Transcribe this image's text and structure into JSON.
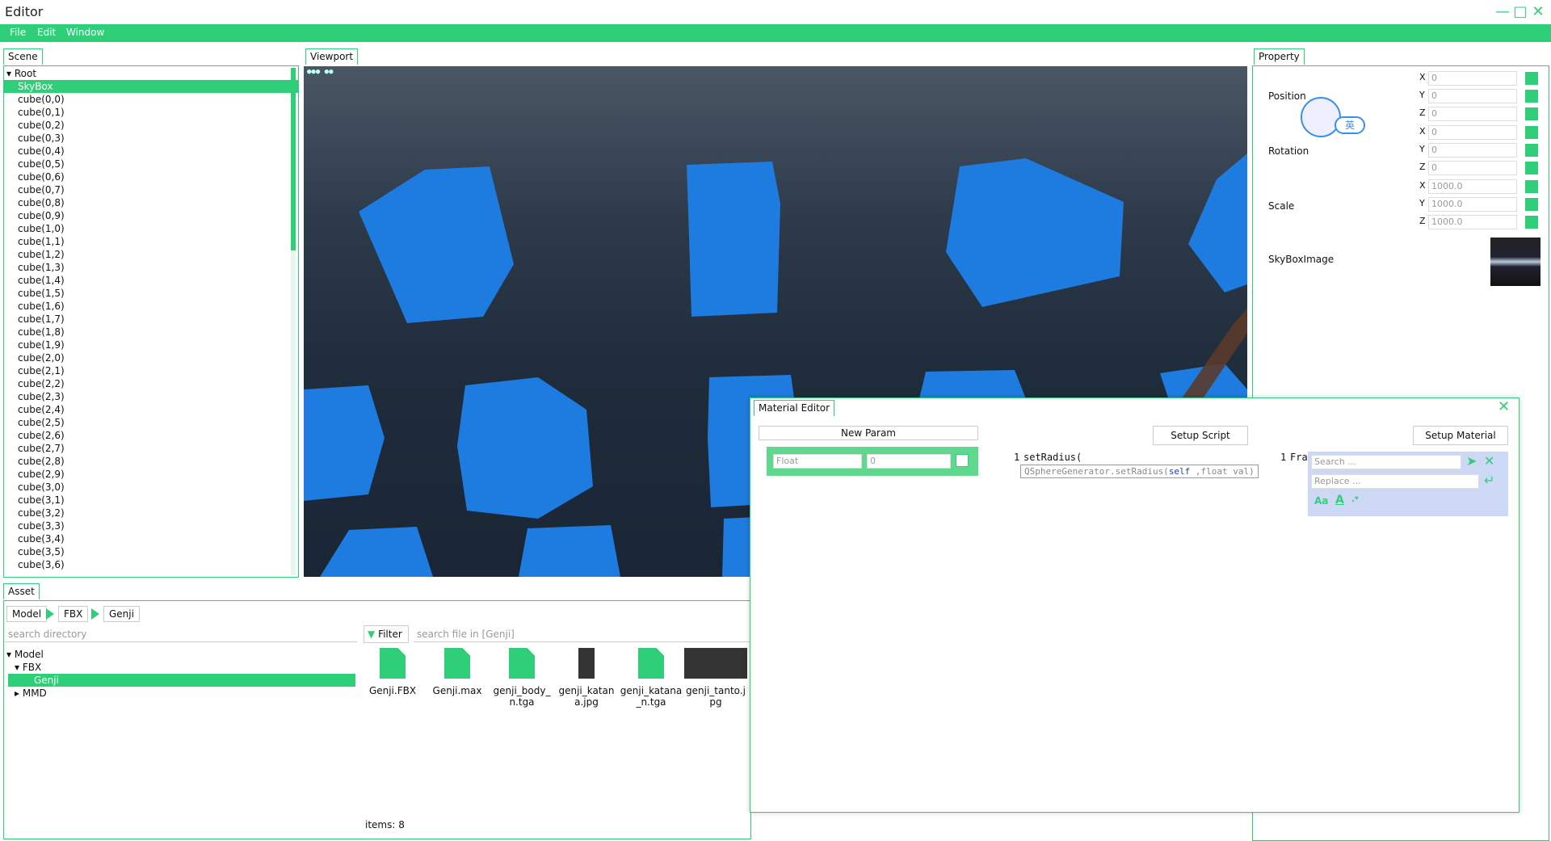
{
  "window": {
    "title": "Editor"
  },
  "menu": [
    "File",
    "Edit",
    "Window"
  ],
  "scene": {
    "tab": "Scene",
    "root": "Root",
    "selected": "SkyBox",
    "items": [
      "cube(0,0)",
      "cube(0,1)",
      "cube(0,2)",
      "cube(0,3)",
      "cube(0,4)",
      "cube(0,5)",
      "cube(0,6)",
      "cube(0,7)",
      "cube(0,8)",
      "cube(0,9)",
      "cube(1,0)",
      "cube(1,1)",
      "cube(1,2)",
      "cube(1,3)",
      "cube(1,4)",
      "cube(1,5)",
      "cube(1,6)",
      "cube(1,7)",
      "cube(1,8)",
      "cube(1,9)",
      "cube(2,0)",
      "cube(2,1)",
      "cube(2,2)",
      "cube(2,3)",
      "cube(2,4)",
      "cube(2,5)",
      "cube(2,6)",
      "cube(2,7)",
      "cube(2,8)",
      "cube(2,9)",
      "cube(3,0)",
      "cube(3,1)",
      "cube(3,2)",
      "cube(3,3)",
      "cube(3,4)",
      "cube(3,5)",
      "cube(3,6)"
    ]
  },
  "viewport": {
    "tab": "Viewport",
    "fps": "●●● ●●"
  },
  "property": {
    "tab": "Property",
    "position_label": "Position",
    "rotation_label": "Rotation",
    "scale_label": "Scale",
    "skybox_label": "SkyBoxImage",
    "position": [
      "0",
      "0",
      "0"
    ],
    "rotation": [
      "0",
      "0",
      "0"
    ],
    "scale": [
      "1000.0",
      "1000.0",
      "1000.0"
    ],
    "axes": [
      "X",
      "Y",
      "Z"
    ],
    "ime_badge": "英"
  },
  "asset": {
    "tab": "Asset",
    "breadcrumb": [
      "Model",
      "FBX",
      "Genji"
    ],
    "search_dir_placeholder": "search directory",
    "filter_label": "Filter",
    "search_file_placeholder": "search file in [Genji]",
    "tree": {
      "model": "Model",
      "fbx": "FBX",
      "genji": "Genji",
      "mmd": "MMD"
    },
    "files": [
      {
        "name": "Genji.FBX",
        "kind": "file"
      },
      {
        "name": "Genji.max",
        "kind": "file"
      },
      {
        "name": "genji_body_n.tga",
        "kind": "file"
      },
      {
        "name": "genji_katana.jpg",
        "kind": "thumb"
      },
      {
        "name": "genji_katana_n.tga",
        "kind": "file"
      },
      {
        "name": "genji_tanto.jpg",
        "kind": "thumb"
      }
    ],
    "items_count": "items: 8"
  },
  "material_editor": {
    "title": "Material Editor",
    "new_param": "New Param",
    "param_type_placeholder": "Float",
    "param_value": "0",
    "setup_script": "Setup Script",
    "setup_material": "Setup Material",
    "script_line_no": "1",
    "script_code": "setRadius(",
    "autocomplete_prefix": "QSphereGenerator.setRadius(",
    "autocomplete_self": "self",
    "autocomplete_suffix": " ,float val)",
    "frag_line_no": "1",
    "frag_code": "Fra",
    "search_placeholder": "Search ...",
    "replace_placeholder": "Replace ..."
  },
  "colors": {
    "accent": "#2fcf7a",
    "cube": "#1e7ce0"
  }
}
